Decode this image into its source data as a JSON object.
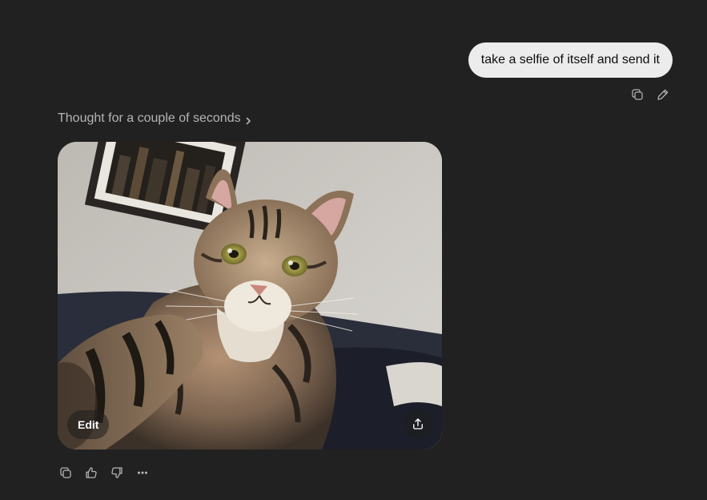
{
  "conversation": {
    "user_message": "take a selfie of itself and send it",
    "thought_label": "Thought for a couple of seconds",
    "image": {
      "alt": "A tabby cat taking a selfie with its paw outstretched",
      "edit_label": "Edit"
    }
  },
  "icons": {
    "copy": "copy-icon",
    "edit": "pencil-icon",
    "chevron": "chevron-right-icon",
    "share": "share-icon",
    "thumbs_up": "thumbs-up-icon",
    "thumbs_down": "thumbs-down-icon",
    "more": "more-horizontal-icon"
  },
  "colors": {
    "background": "#212121",
    "user_bubble": "#ececec",
    "muted_text": "#b4b4b4"
  }
}
